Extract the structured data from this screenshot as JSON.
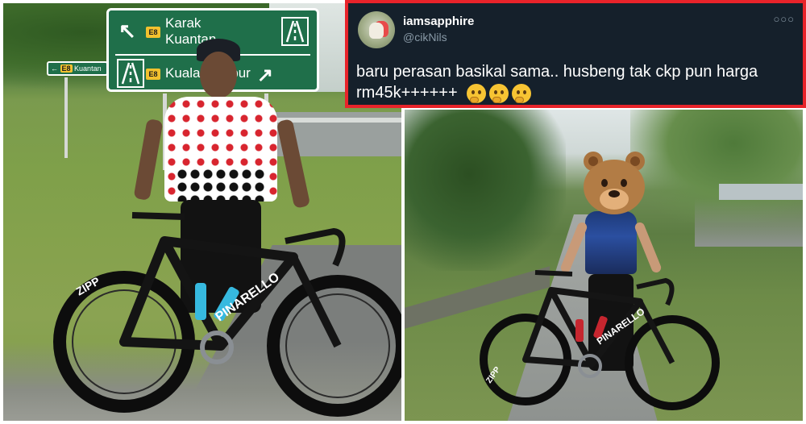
{
  "tweet": {
    "display_name": "iamsapphire",
    "handle": "@cikNils",
    "more_icon": "more-options-icon",
    "text": "baru perasan basikal sama.. husbeng tak ckp pun harga rm45k++++++",
    "emojis": [
      "thinking-face",
      "thinking-face",
      "thinking-face"
    ],
    "border_color": "#e8232a",
    "background": "#15202b"
  },
  "left_photo": {
    "sign_main": {
      "row1_places": [
        "Karak",
        "Kuantan"
      ],
      "row1_route": "E8",
      "row2_place": "Kuala Lumpur",
      "row2_route": "E8"
    },
    "sign_small": {
      "route": "E8",
      "place": "Kuantan"
    },
    "bike_brand": "PINARELLO",
    "wheel_brand": "ZIPP"
  },
  "right_photo": {
    "bike_brand": "PINARELLO",
    "wheel_brand": "ZIPP",
    "face_cover": "bear-face"
  }
}
